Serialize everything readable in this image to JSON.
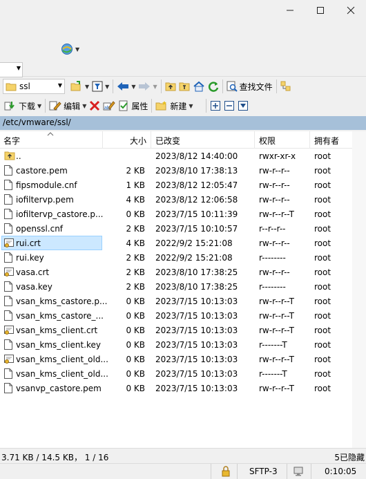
{
  "toolbar": {
    "path_combo": "ssl",
    "download": "下载",
    "edit": "编辑",
    "properties": "属性",
    "new": "新建",
    "find_files": "查找文件"
  },
  "path": "/etc/vmware/ssl/",
  "columns": {
    "name": "名字",
    "size": "大小",
    "changed": "已改变",
    "rights": "权限",
    "owner": "拥有者"
  },
  "files": [
    {
      "name": "..",
      "size": "",
      "changed": "2023/8/12 14:40:00",
      "rights": "rwxr-xr-x",
      "owner": "root",
      "icon": "parent-folder-icon"
    },
    {
      "name": "castore.pem",
      "size": "2 KB",
      "changed": "2023/8/10 17:38:13",
      "rights": "rw-r--r--",
      "owner": "root",
      "icon": "file-icon"
    },
    {
      "name": "fipsmodule.cnf",
      "size": "1 KB",
      "changed": "2023/8/12 12:05:47",
      "rights": "rw-r--r--",
      "owner": "root",
      "icon": "file-icon"
    },
    {
      "name": "iofiltervp.pem",
      "size": "4 KB",
      "changed": "2023/8/12 12:06:58",
      "rights": "rw-r--r--",
      "owner": "root",
      "icon": "file-icon"
    },
    {
      "name": "iofiltervp_castore.p...",
      "size": "0 KB",
      "changed": "2023/7/15 10:11:39",
      "rights": "rw-r--r--T",
      "owner": "root",
      "icon": "file-icon"
    },
    {
      "name": "openssl.cnf",
      "size": "2 KB",
      "changed": "2023/7/15 10:10:57",
      "rights": "r--r--r--",
      "owner": "root",
      "icon": "file-icon"
    },
    {
      "name": "rui.crt",
      "size": "4 KB",
      "changed": "2022/9/2 15:21:08",
      "rights": "rw-r--r--",
      "owner": "root",
      "icon": "certificate-icon"
    },
    {
      "name": "rui.key",
      "size": "2 KB",
      "changed": "2022/9/2 15:21:08",
      "rights": "r--------",
      "owner": "root",
      "icon": "file-icon"
    },
    {
      "name": "vasa.crt",
      "size": "2 KB",
      "changed": "2023/8/10 17:38:25",
      "rights": "rw-r--r--",
      "owner": "root",
      "icon": "certificate-icon"
    },
    {
      "name": "vasa.key",
      "size": "2 KB",
      "changed": "2023/8/10 17:38:25",
      "rights": "r--------",
      "owner": "root",
      "icon": "file-icon"
    },
    {
      "name": "vsan_kms_castore.p...",
      "size": "0 KB",
      "changed": "2023/7/15 10:13:03",
      "rights": "rw-r--r--T",
      "owner": "root",
      "icon": "file-icon"
    },
    {
      "name": "vsan_kms_castore_...",
      "size": "0 KB",
      "changed": "2023/7/15 10:13:03",
      "rights": "rw-r--r--T",
      "owner": "root",
      "icon": "file-icon"
    },
    {
      "name": "vsan_kms_client.crt",
      "size": "0 KB",
      "changed": "2023/7/15 10:13:03",
      "rights": "rw-r--r--T",
      "owner": "root",
      "icon": "certificate-icon"
    },
    {
      "name": "vsan_kms_client.key",
      "size": "0 KB",
      "changed": "2023/7/15 10:13:03",
      "rights": "r-------T",
      "owner": "root",
      "icon": "file-icon"
    },
    {
      "name": "vsan_kms_client_old...",
      "size": "0 KB",
      "changed": "2023/7/15 10:13:03",
      "rights": "rw-r--r--T",
      "owner": "root",
      "icon": "certificate-icon"
    },
    {
      "name": "vsan_kms_client_old...",
      "size": "0 KB",
      "changed": "2023/7/15 10:13:03",
      "rights": "r-------T",
      "owner": "root",
      "icon": "file-icon"
    },
    {
      "name": "vsanvp_castore.pem",
      "size": "0 KB",
      "changed": "2023/7/15 10:13:03",
      "rights": "rw-r--r--T",
      "owner": "root",
      "icon": "file-icon"
    }
  ],
  "selected_index": 6,
  "status": {
    "selection": "3.71 KB / 14.5 KB，  1 / 16",
    "hidden": "5已隐藏",
    "protocol": "SFTP-3",
    "time": "0:10:05"
  },
  "colors": {
    "path_bar": "#a6c0d9",
    "selection": "#cce8ff",
    "accent_blue": "#1f63b8",
    "red_x": "#d92020"
  }
}
